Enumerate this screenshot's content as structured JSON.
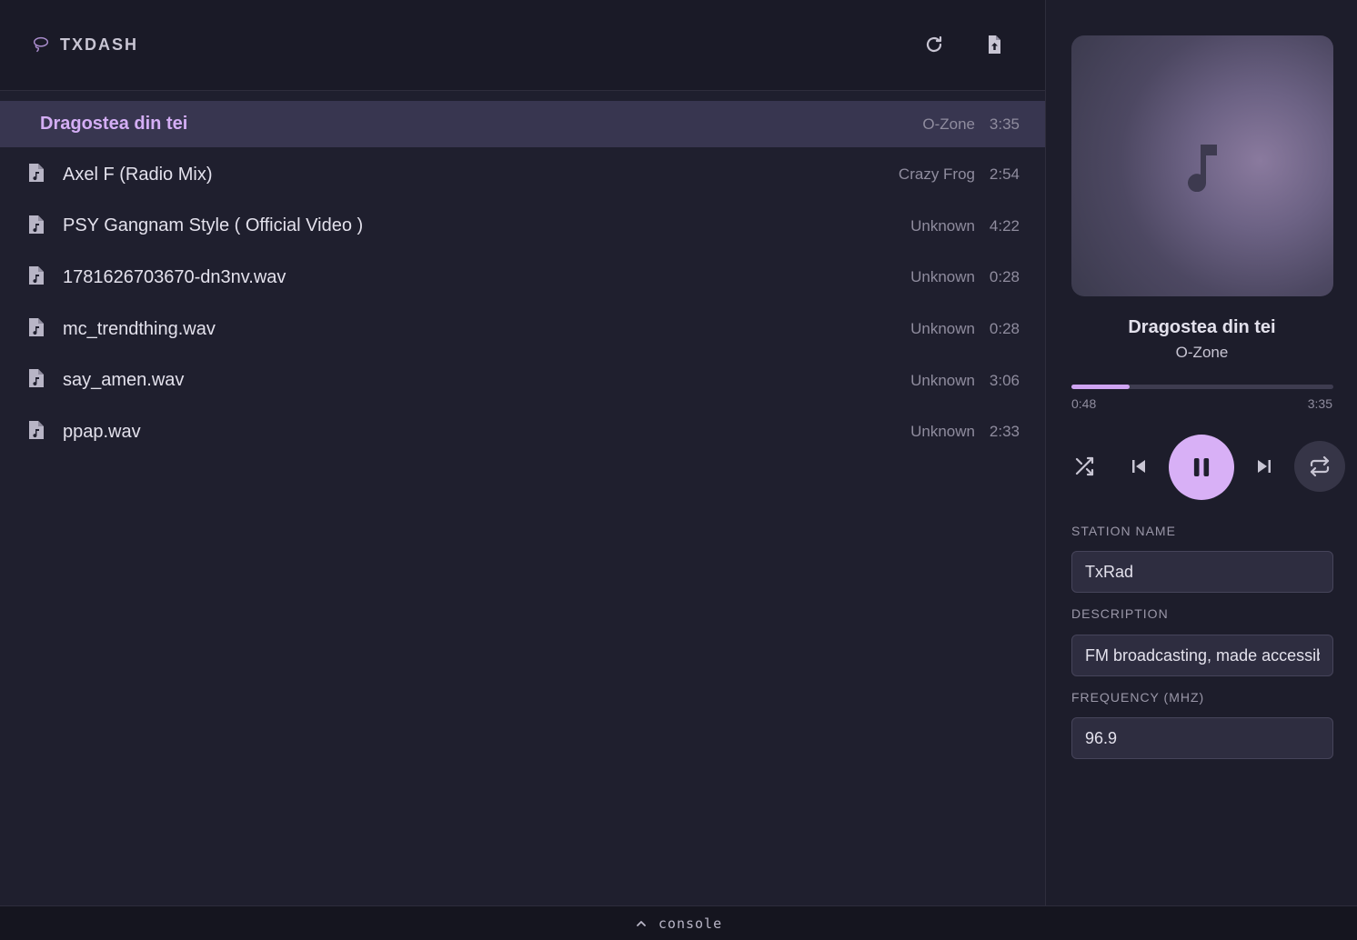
{
  "header": {
    "brand": "TXDASH",
    "icons": {
      "logo": "lasso-icon",
      "refresh": "refresh-icon",
      "upload": "file-upload-icon"
    }
  },
  "playlist": {
    "current": {
      "title": "Dragostea din tei",
      "artist": "O-Zone",
      "duration": "3:35"
    },
    "items": [
      {
        "title": "Axel F (Radio Mix)",
        "artist": "Crazy Frog",
        "duration": "2:54"
      },
      {
        "title": "PSY Gangnam Style ( Official Video )",
        "artist": "Unknown",
        "duration": "4:22"
      },
      {
        "title": "1781626703670-dn3nv.wav",
        "artist": "Unknown",
        "duration": "0:28"
      },
      {
        "title": "mc_trendthing.wav",
        "artist": "Unknown",
        "duration": "0:28"
      },
      {
        "title": "say_amen.wav",
        "artist": "Unknown",
        "duration": "3:06"
      },
      {
        "title": "ppap.wav",
        "artist": "Unknown",
        "duration": "2:33"
      }
    ]
  },
  "player": {
    "title": "Dragostea din tei",
    "artist": "O-Zone",
    "elapsed": "0:48",
    "total": "3:35",
    "progress": 0.223,
    "controls": {
      "shuffle": "shuffle-icon",
      "previous": "skip-previous-icon",
      "play_pause": "pause-icon",
      "next": "skip-next-icon",
      "repeat": "repeat-icon"
    }
  },
  "station": {
    "name_label": "STATION NAME",
    "name_value": "TxRad",
    "description_label": "DESCRIPTION",
    "description_value": "FM broadcasting, made accessible",
    "frequency_label": "FREQUENCY (MHZ)",
    "frequency_value": "96.9"
  },
  "console": {
    "label": "console"
  },
  "colors": {
    "accent": "#d8b0f6",
    "background": "#1f1f2e",
    "highlight_row": "#383650"
  }
}
